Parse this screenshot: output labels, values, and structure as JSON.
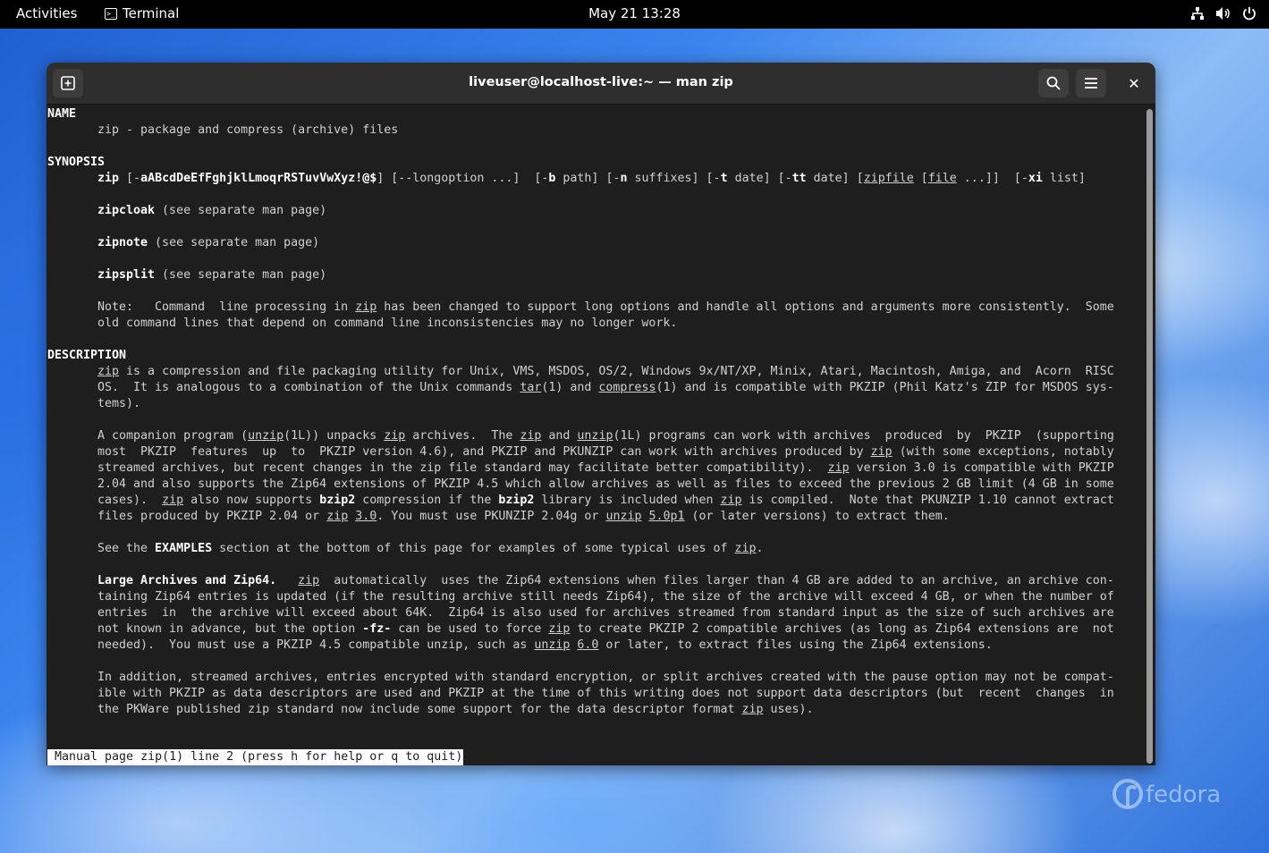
{
  "topbar": {
    "activities": "Activities",
    "app_name": "Terminal",
    "clock": "May 21  13:28",
    "tray_icons": [
      "network-icon",
      "volume-icon",
      "power-icon"
    ]
  },
  "desktop": {
    "watermark": "fedora"
  },
  "window": {
    "title": "liveuser@localhost-live:~ — man zip",
    "close_glyph": "✕"
  },
  "manpage": {
    "lines": [
      {
        "indent": false,
        "segs": [
          {
            "t": "NAME",
            "s": "b"
          }
        ]
      },
      {
        "indent": true,
        "segs": [
          {
            "t": "zip - package and compress (archive) files"
          }
        ]
      },
      {
        "indent": false,
        "segs": [
          {
            "t": ""
          }
        ]
      },
      {
        "indent": false,
        "segs": [
          {
            "t": "SYNOPSIS",
            "s": "b"
          }
        ]
      },
      {
        "indent": true,
        "segs": [
          {
            "t": "zip",
            "s": "b"
          },
          {
            "t": " [-"
          },
          {
            "t": "aABcdDeEfFghjklLmoqrRSTuvVwXyz!@$",
            "s": "b"
          },
          {
            "t": "] [--longoption ...]  [-"
          },
          {
            "t": "b",
            "s": "b"
          },
          {
            "t": " path] [-"
          },
          {
            "t": "n",
            "s": "b"
          },
          {
            "t": " suffixes] [-"
          },
          {
            "t": "t",
            "s": "b"
          },
          {
            "t": " date] [-"
          },
          {
            "t": "tt",
            "s": "b"
          },
          {
            "t": " date] ["
          },
          {
            "t": "zipfile",
            "s": "u"
          },
          {
            "t": " ["
          },
          {
            "t": "file",
            "s": "u"
          },
          {
            "t": " ...]]  [-"
          },
          {
            "t": "xi",
            "s": "b"
          },
          {
            "t": " list]"
          }
        ]
      },
      {
        "indent": false,
        "segs": [
          {
            "t": ""
          }
        ]
      },
      {
        "indent": true,
        "segs": [
          {
            "t": "zipcloak",
            "s": "b"
          },
          {
            "t": " (see separate man page)"
          }
        ]
      },
      {
        "indent": false,
        "segs": [
          {
            "t": ""
          }
        ]
      },
      {
        "indent": true,
        "segs": [
          {
            "t": "zipnote",
            "s": "b"
          },
          {
            "t": " (see separate man page)"
          }
        ]
      },
      {
        "indent": false,
        "segs": [
          {
            "t": ""
          }
        ]
      },
      {
        "indent": true,
        "segs": [
          {
            "t": "zipsplit",
            "s": "b"
          },
          {
            "t": " (see separate man page)"
          }
        ]
      },
      {
        "indent": false,
        "segs": [
          {
            "t": ""
          }
        ]
      },
      {
        "indent": true,
        "segs": [
          {
            "t": "Note:   Command  line processing in "
          },
          {
            "t": "zip",
            "s": "u"
          },
          {
            "t": " has been changed to support long options and handle all options and arguments more consistently.  Some"
          }
        ]
      },
      {
        "indent": true,
        "segs": [
          {
            "t": "old command lines that depend on command line inconsistencies may no longer work."
          }
        ]
      },
      {
        "indent": false,
        "segs": [
          {
            "t": ""
          }
        ]
      },
      {
        "indent": false,
        "segs": [
          {
            "t": "DESCRIPTION",
            "s": "b"
          }
        ]
      },
      {
        "indent": true,
        "segs": [
          {
            "t": "zip",
            "s": "u"
          },
          {
            "t": " is a compression and file packaging utility for Unix, VMS, MSDOS, OS/2, Windows 9x/NT/XP, Minix, Atari, Macintosh, Amiga, and  Acorn  RISC"
          }
        ]
      },
      {
        "indent": true,
        "segs": [
          {
            "t": "OS.  It is analogous to a combination of the Unix commands "
          },
          {
            "t": "tar",
            "s": "u"
          },
          {
            "t": "(1) and "
          },
          {
            "t": "compress",
            "s": "u"
          },
          {
            "t": "(1) and is compatible with PKZIP (Phil Katz's ZIP for MSDOS sys‐"
          }
        ]
      },
      {
        "indent": true,
        "segs": [
          {
            "t": "tems)."
          }
        ]
      },
      {
        "indent": false,
        "segs": [
          {
            "t": ""
          }
        ]
      },
      {
        "indent": true,
        "segs": [
          {
            "t": "A companion program ("
          },
          {
            "t": "unzip",
            "s": "u"
          },
          {
            "t": "(1L)) unpacks "
          },
          {
            "t": "zip",
            "s": "u"
          },
          {
            "t": " archives.  The "
          },
          {
            "t": "zip",
            "s": "u"
          },
          {
            "t": " and "
          },
          {
            "t": "unzip",
            "s": "u"
          },
          {
            "t": "(1L) programs can work with archives  produced  by  PKZIP  (supporting"
          }
        ]
      },
      {
        "indent": true,
        "segs": [
          {
            "t": "most  PKZIP  features  up  to  PKZIP version 4.6), and PKZIP and PKUNZIP can work with archives produced by "
          },
          {
            "t": "zip",
            "s": "u"
          },
          {
            "t": " (with some exceptions, notably"
          }
        ]
      },
      {
        "indent": true,
        "segs": [
          {
            "t": "streamed archives, but recent changes in the zip file standard may facilitate better compatibility).  "
          },
          {
            "t": "zip",
            "s": "u"
          },
          {
            "t": " version 3.0 is compatible with PKZIP"
          }
        ]
      },
      {
        "indent": true,
        "segs": [
          {
            "t": "2.04 and also supports the Zip64 extensions of PKZIP 4.5 which allow archives as well as files to exceed the previous 2 GB limit (4 GB in some"
          }
        ]
      },
      {
        "indent": true,
        "segs": [
          {
            "t": "cases).  "
          },
          {
            "t": "zip",
            "s": "u"
          },
          {
            "t": " also now supports "
          },
          {
            "t": "bzip2",
            "s": "b"
          },
          {
            "t": " compression if the "
          },
          {
            "t": "bzip2",
            "s": "b"
          },
          {
            "t": " library is included when "
          },
          {
            "t": "zip",
            "s": "u"
          },
          {
            "t": " is compiled.  Note that PKUNZIP 1.10 cannot extract"
          }
        ]
      },
      {
        "indent": true,
        "segs": [
          {
            "t": "files produced by PKZIP 2.04 or "
          },
          {
            "t": "zip",
            "s": "u"
          },
          {
            "t": " "
          },
          {
            "t": "3.0",
            "s": "u"
          },
          {
            "t": ". You must use PKUNZIP 2.04g or "
          },
          {
            "t": "unzip",
            "s": "u"
          },
          {
            "t": " "
          },
          {
            "t": "5.0p1",
            "s": "u"
          },
          {
            "t": " (or later versions) to extract them."
          }
        ]
      },
      {
        "indent": false,
        "segs": [
          {
            "t": ""
          }
        ]
      },
      {
        "indent": true,
        "segs": [
          {
            "t": "See the "
          },
          {
            "t": "EXAMPLES",
            "s": "b"
          },
          {
            "t": " section at the bottom of this page for examples of some typical uses of "
          },
          {
            "t": "zip",
            "s": "u"
          },
          {
            "t": "."
          }
        ]
      },
      {
        "indent": false,
        "segs": [
          {
            "t": ""
          }
        ]
      },
      {
        "indent": true,
        "segs": [
          {
            "t": "Large Archives and Zip64.",
            "s": "b"
          },
          {
            "t": "   "
          },
          {
            "t": "zip",
            "s": "u"
          },
          {
            "t": "  automatically  uses the Zip64 extensions when files larger than 4 GB are added to an archive, an archive con‐"
          }
        ]
      },
      {
        "indent": true,
        "segs": [
          {
            "t": "taining Zip64 entries is updated (if the resulting archive still needs Zip64), the size of the archive will exceed 4 GB, or when the number of"
          }
        ]
      },
      {
        "indent": true,
        "segs": [
          {
            "t": "entries  in  the archive will exceed about 64K.  Zip64 is also used for archives streamed from standard input as the size of such archives are"
          }
        ]
      },
      {
        "indent": true,
        "segs": [
          {
            "t": "not known in advance, but the option "
          },
          {
            "t": "-fz-",
            "s": "b"
          },
          {
            "t": " can be used to force "
          },
          {
            "t": "zip",
            "s": "u"
          },
          {
            "t": " to create PKZIP 2 compatible archives (as long as Zip64 extensions are  not"
          }
        ]
      },
      {
        "indent": true,
        "segs": [
          {
            "t": "needed).  You must use a PKZIP 4.5 compatible unzip, such as "
          },
          {
            "t": "unzip",
            "s": "u"
          },
          {
            "t": " "
          },
          {
            "t": "6.0",
            "s": "u"
          },
          {
            "t": " or later, to extract files using the Zip64 extensions."
          }
        ]
      },
      {
        "indent": false,
        "segs": [
          {
            "t": ""
          }
        ]
      },
      {
        "indent": true,
        "segs": [
          {
            "t": "In addition, streamed archives, entries encrypted with standard encryption, or split archives created with the pause option may not be compat‐"
          }
        ]
      },
      {
        "indent": true,
        "segs": [
          {
            "t": "ible with PKZIP as data descriptors are used and PKZIP at the time of this writing does not support data descriptors (but  recent  changes  in"
          }
        ]
      },
      {
        "indent": true,
        "segs": [
          {
            "t": "the PKWare published zip standard now include some support for the data descriptor format "
          },
          {
            "t": "zip",
            "s": "u"
          },
          {
            "t": " uses)."
          }
        ]
      }
    ],
    "status": "Manual page zip(1) line 2 (press h for help or q to quit)"
  }
}
